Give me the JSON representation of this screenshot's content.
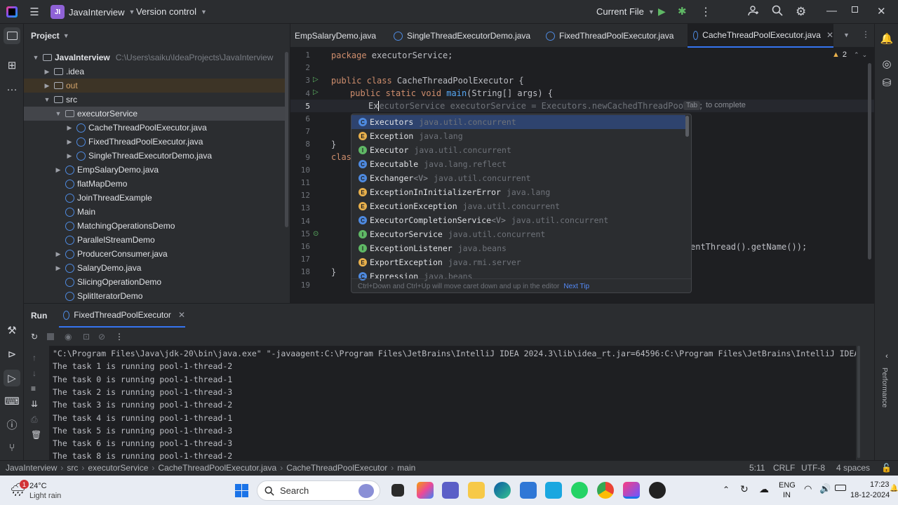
{
  "titlebar": {
    "project_badge": "JI",
    "project_name": "JavaInterview",
    "vcs": "Version control",
    "run_config": "Current File"
  },
  "project": {
    "title": "Project",
    "root": "JavaInterview",
    "root_path": "C:\\Users\\saiku\\IdeaProjects\\JavaInterview",
    "items": [
      {
        "label": ".idea"
      },
      {
        "label": "out"
      },
      {
        "label": "src"
      },
      {
        "label": "executorService"
      },
      {
        "label": "CacheThreadPoolExecutor.java"
      },
      {
        "label": "FixedThreadPoolExecutor.java"
      },
      {
        "label": "SingleThreadExecutorDemo.java"
      },
      {
        "label": "EmpSalaryDemo.java"
      },
      {
        "label": "flatMapDemo"
      },
      {
        "label": "JoinThreadExample"
      },
      {
        "label": "Main"
      },
      {
        "label": "MatchingOperationsDemo"
      },
      {
        "label": "ParallelStreamDemo"
      },
      {
        "label": "ProducerConsumer.java"
      },
      {
        "label": "SalaryDemo.java"
      },
      {
        "label": "SlicingOperationDemo"
      },
      {
        "label": "SplitIteratorDemo"
      }
    ]
  },
  "tabs": [
    "EmpSalaryDemo.java",
    "SingleThreadExecutorDemo.java",
    "FixedThreadPoolExecutor.java",
    "CacheThreadPoolExecutor.java"
  ],
  "editor": {
    "warnings": "2",
    "lines": [
      "1",
      "2",
      "3",
      "4",
      "5",
      "6",
      "7",
      "8",
      "9",
      "10",
      "11",
      "12",
      "13",
      "14",
      "15",
      "16",
      "17",
      "18",
      "19"
    ],
    "l1_kw": "package",
    "l1_rest": " executorService;",
    "l3_kw": "public class",
    "l3_rest": " CacheThreadPoolExecutor {",
    "l4_kw": "public static void",
    "l4_fn": " main",
    "l4_rest": "(String[] args) {",
    "l5_typed": "Ex",
    "l5_hint": "ecutorService executorService = Executors.newCachedThreadPool();",
    "tab_key": "Tab",
    "to_complete": "to complete",
    "l8": "}",
    "l9": "clas",
    "l16": "entThread().getName());",
    "l18": "}"
  },
  "completion": {
    "items": [
      {
        "name": "Executors",
        "pkg": "java.util.concurrent",
        "kind": "c"
      },
      {
        "name": "Exception",
        "pkg": "java.lang",
        "kind": "e"
      },
      {
        "name": "Executor",
        "pkg": "java.util.concurrent",
        "kind": "i"
      },
      {
        "name": "Executable",
        "pkg": "java.lang.reflect",
        "kind": "c"
      },
      {
        "name": "Exchanger",
        "gen": "<V>",
        "pkg": "java.util.concurrent",
        "kind": "c"
      },
      {
        "name": "ExceptionInInitializerError",
        "pkg": "java.lang",
        "kind": "e"
      },
      {
        "name": "ExecutionException",
        "pkg": "java.util.concurrent",
        "kind": "e"
      },
      {
        "name": "ExecutorCompletionService",
        "gen": "<V>",
        "pkg": "java.util.concurrent",
        "kind": "c"
      },
      {
        "name": "ExecutorService",
        "pkg": "java.util.concurrent",
        "kind": "i"
      },
      {
        "name": "ExceptionListener",
        "pkg": "java.beans",
        "kind": "i"
      },
      {
        "name": "ExportException",
        "pkg": "java.rmi.server",
        "kind": "e"
      },
      {
        "name": "Expression",
        "pkg": "java.beans",
        "kind": "c"
      }
    ],
    "footer": "Ctrl+Down and Ctrl+Up will move caret down and up in the editor",
    "next_tip": "Next Tip"
  },
  "run": {
    "title": "Run",
    "tab": "FixedThreadPoolExecutor",
    "lines": [
      "\"C:\\Program Files\\Java\\jdk-20\\bin\\java.exe\" \"-javaagent:C:\\Program Files\\JetBrains\\IntelliJ IDEA 2024.3\\lib\\idea_rt.jar=64596:C:\\Program Files\\JetBrains\\IntelliJ IDEA 2024",
      "The task 1 is running pool-1-thread-2",
      "The task 0 is running pool-1-thread-1",
      "The task 2 is running pool-1-thread-3",
      "The task 3 is running pool-1-thread-2",
      "The task 4 is running pool-1-thread-1",
      "The task 5 is running pool-1-thread-3",
      "The task 6 is running pool-1-thread-3",
      "The task 8 is running pool-1-thread-2"
    ]
  },
  "right_panel": {
    "performance": "Performance"
  },
  "status": {
    "crumbs": [
      "JavaInterview",
      "src",
      "executorService",
      "CacheThreadPoolExecutor.java",
      "CacheThreadPoolExecutor",
      "main"
    ],
    "position": "5:11",
    "line_sep": "CRLF",
    "encoding": "UTF-8",
    "indent": "4 spaces"
  },
  "taskbar": {
    "temp": "24°C",
    "weather": "Light rain",
    "weather_badge": "1",
    "search": "Search",
    "lang1": "ENG",
    "lang2": "IN",
    "time": "17:23",
    "date": "18-12-2024"
  },
  "colors": {
    "accent": "#3574f0",
    "bg": "#1e1f22",
    "panel": "#2b2d30"
  }
}
